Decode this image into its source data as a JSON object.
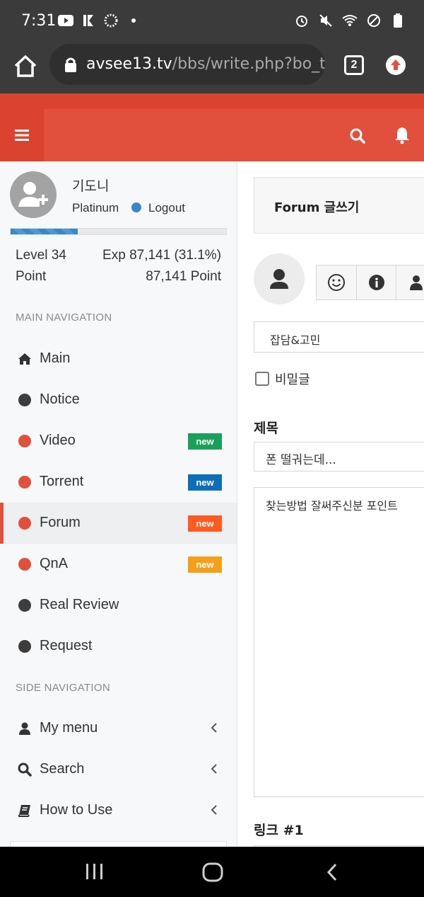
{
  "status_bar": {
    "time": "7:31"
  },
  "browser": {
    "url_host": "avsee13.tv",
    "url_path": "/bbs/write.php?bo_ta",
    "tab_count": "2"
  },
  "user": {
    "name": "기도니",
    "grade": "Platinum",
    "logout_label": "Logout",
    "level_label": "Level 34",
    "exp_label": "Exp 87,141 (31.1%)",
    "exp_percent": 31.1,
    "point_label": "Point",
    "point_value": "87,141 Point"
  },
  "main_navigation": {
    "title": "MAIN NAVIGATION",
    "items": [
      {
        "label": "Main",
        "icon": "home-icon"
      },
      {
        "label": "Notice",
        "dot_color": "#3d3d3d"
      },
      {
        "label": "Video",
        "dot_color": "#e0503c",
        "badge": "new",
        "badge_color": "#1aa05a"
      },
      {
        "label": "Torrent",
        "dot_color": "#e0503c",
        "badge": "new",
        "badge_color": "#0e6fb8"
      },
      {
        "label": "Forum",
        "dot_color": "#e0503c",
        "badge": "new",
        "badge_color": "#ff5a1f",
        "active": true
      },
      {
        "label": "QnA",
        "dot_color": "#e0503c",
        "badge": "new",
        "badge_color": "#f5a01a"
      },
      {
        "label": "Real Review",
        "dot_color": "#3d3d3d"
      },
      {
        "label": "Request",
        "dot_color": "#3d3d3d"
      }
    ]
  },
  "side_navigation": {
    "title": "SIDE NAVIGATION",
    "items": [
      {
        "label": "My menu",
        "icon": "user-icon"
      },
      {
        "label": "Search",
        "icon": "search-icon"
      },
      {
        "label": "How to Use",
        "icon": "book-icon"
      }
    ]
  },
  "form": {
    "board_title": "Forum 글쓰기",
    "category_value": "잡담&고민",
    "secret_label": "비밀글",
    "subject_label": "제목",
    "subject_value": "폰 떨궈는데...",
    "body_value": "찾는방법 잘써주신분 포인트",
    "link_label": "링크 #1"
  },
  "colors": {
    "header_red": "#d9432f",
    "accent_red": "#e0503c",
    "chrome_dark": "#3b3b3b"
  }
}
